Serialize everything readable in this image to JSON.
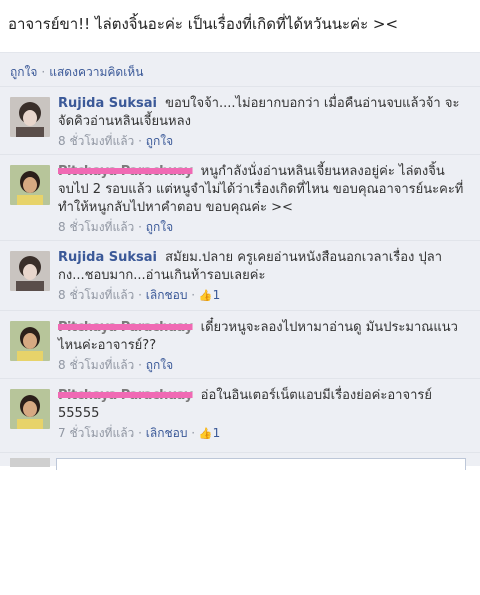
{
  "post": {
    "text": "อาจารย์ขา!! ไล่ตงจิ้นอะค่ะ เป็นเรื่องที่เกิดที่ได้หวันนะค่ะ ><"
  },
  "actions": {
    "like_label": "ถูกใจ",
    "comment_label": "แสดงความคิดเห็น"
  },
  "comments": [
    {
      "author": "Rujida Suksai",
      "text": "ขอบใจจ้า....ไม่อยากบอกว่า เมื่อคืนอ่านจบแล้วจ้า จะจัดคิวอ่านหลินเจี้ยนหลง",
      "time": "8 ชั่วโมงที่แล้ว",
      "action": "ถูกใจ",
      "likes": ""
    },
    {
      "author": "Pitchaya Parachuay",
      "text": "หนูกำลังนั่งอ่านหลินเจี้ยนหลงอยู่ค่ะ ไล่ตงจิ้น จบไป 2 รอบแล้ว แต่หนูจำไม่ได้ว่าเรื่องเกิดที่ไหน ขอบคุณอาจารย์นะคะที่ทำให้หนูกลับไปหาคำตอบ ขอบคุณค่ะ ><",
      "time": "8 ชั่วโมงที่แล้ว",
      "action": "ถูกใจ",
      "likes": ""
    },
    {
      "author": "Rujida Suksai",
      "text": "สมัยม.ปลาย ครูเคยอ่านหนังสือนอกเวลาเรื่อง ปุลากง...ชอบมาก...อ่านเกินห้ารอบเลยค่ะ",
      "time": "8 ชั่วโมงที่แล้ว",
      "action": "เลิกชอบ",
      "likes": "1"
    },
    {
      "author": "Pitchaya Parachuay",
      "text": "เดี๋ยวหนูจะลองไปหามาอ่านดู มันประมาณแนวไหนค่ะอาจารย์??",
      "time": "8 ชั่วโมงที่แล้ว",
      "action": "ถูกใจ",
      "likes": ""
    },
    {
      "author": "Pitchaya Parachuay",
      "text": "อ่อในอินเตอร์เน็ตแอบมีเรื่องย่อค่ะอาจารย์ 55555",
      "time": "7 ชั่วโมงที่แล้ว",
      "action": "เลิกชอบ",
      "likes": "1"
    }
  ],
  "icons": {
    "like": "thumbs-up-icon"
  },
  "colors": {
    "link": "#3b5998",
    "background": "#edeff4",
    "redaction": "#f06ab4"
  }
}
